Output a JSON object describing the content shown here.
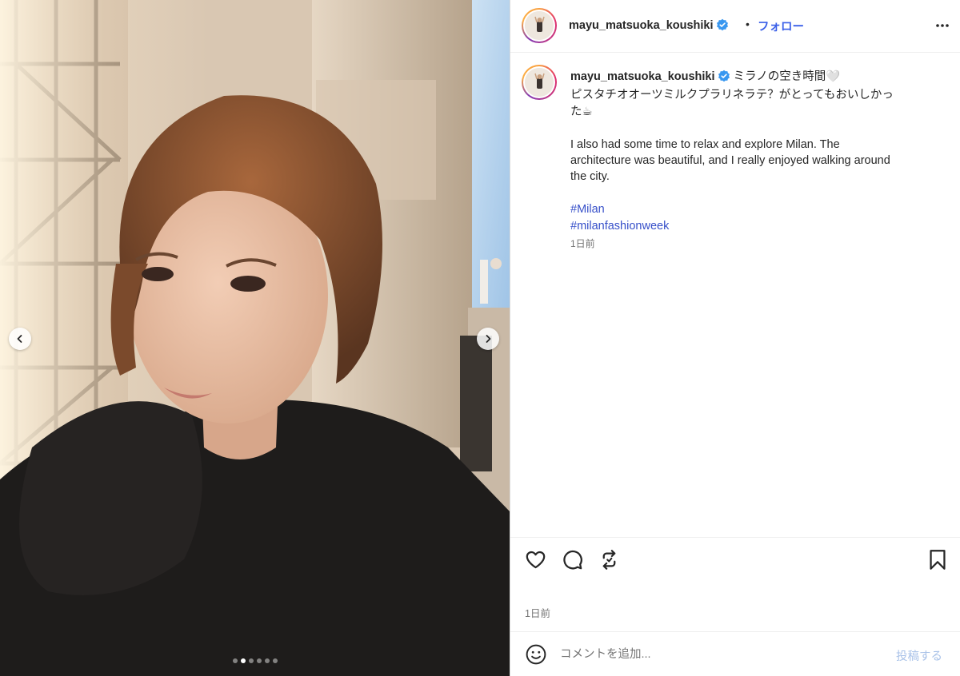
{
  "post": {
    "username": "mayu_matsuoka_koushiki",
    "separator": "•",
    "follow_label": "フォロー",
    "caption_lines": [
      "ミラノの空き時間🤍",
      "ピスタチオオーツミルクプラリネラテ？がとってもおいしかっ",
      "た☕",
      "",
      "I also had some time to relax and explore Milan. The",
      "architecture was beautiful, and I really enjoyed walking around",
      "the city."
    ],
    "hashtags": [
      "#Milan",
      "#milanfashionweek"
    ],
    "caption_time": "1日前",
    "post_time": "1日前"
  },
  "comment": {
    "placeholder": "コメントを追加...",
    "submit_label": "投稿する"
  },
  "carousel": {
    "slide_count": 6,
    "active_index": 1
  },
  "icons": {
    "verified": "verified-badge-icon",
    "more": "more-options-icon",
    "like": "heart-icon",
    "comment": "comment-icon",
    "share": "repost-icon",
    "save": "bookmark-icon",
    "emoji": "emoji-icon",
    "prev": "chevron-left-icon",
    "next": "chevron-right-icon"
  },
  "colors": {
    "accent": "#0095f6",
    "verified": "#0095f6",
    "text": "#262626",
    "muted": "#737373"
  }
}
